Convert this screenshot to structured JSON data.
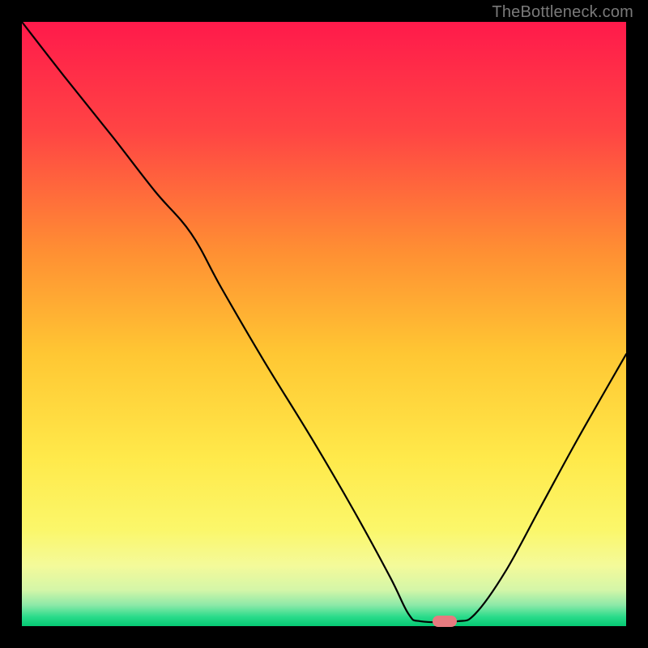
{
  "watermark": "TheBottleneck.com",
  "chart_data": {
    "type": "line",
    "title": "",
    "xlabel": "",
    "ylabel": "",
    "xlim": [
      0,
      100
    ],
    "ylim": [
      0,
      100
    ],
    "grid": false,
    "legend": false,
    "background_gradient": {
      "stops": [
        {
          "pos": 0.0,
          "color": "#ff1a4b"
        },
        {
          "pos": 0.18,
          "color": "#ff4444"
        },
        {
          "pos": 0.38,
          "color": "#ff8f33"
        },
        {
          "pos": 0.55,
          "color": "#ffc733"
        },
        {
          "pos": 0.72,
          "color": "#ffe94a"
        },
        {
          "pos": 0.84,
          "color": "#fbf76a"
        },
        {
          "pos": 0.9,
          "color": "#f4fa9a"
        },
        {
          "pos": 0.94,
          "color": "#d4f6a8"
        },
        {
          "pos": 0.965,
          "color": "#8de9a8"
        },
        {
          "pos": 0.985,
          "color": "#28db8a"
        },
        {
          "pos": 1.0,
          "color": "#05c973"
        }
      ]
    },
    "series": [
      {
        "name": "bottleneck-curve",
        "color": "#000000",
        "points": [
          {
            "x": 0,
            "y": 100
          },
          {
            "x": 7,
            "y": 91
          },
          {
            "x": 15,
            "y": 81
          },
          {
            "x": 22,
            "y": 72
          },
          {
            "x": 28,
            "y": 65
          },
          {
            "x": 33,
            "y": 56
          },
          {
            "x": 40,
            "y": 44
          },
          {
            "x": 48,
            "y": 31
          },
          {
            "x": 55,
            "y": 19
          },
          {
            "x": 61,
            "y": 8
          },
          {
            "x": 64,
            "y": 2
          },
          {
            "x": 66,
            "y": 0.8
          },
          {
            "x": 72,
            "y": 0.8
          },
          {
            "x": 75,
            "y": 2
          },
          {
            "x": 80,
            "y": 9
          },
          {
            "x": 86,
            "y": 20
          },
          {
            "x": 92,
            "y": 31
          },
          {
            "x": 100,
            "y": 45
          }
        ]
      }
    ],
    "marker": {
      "name": "optimal-point",
      "x": 70,
      "y": 0.8,
      "color": "#e77a7f",
      "shape": "pill"
    }
  }
}
